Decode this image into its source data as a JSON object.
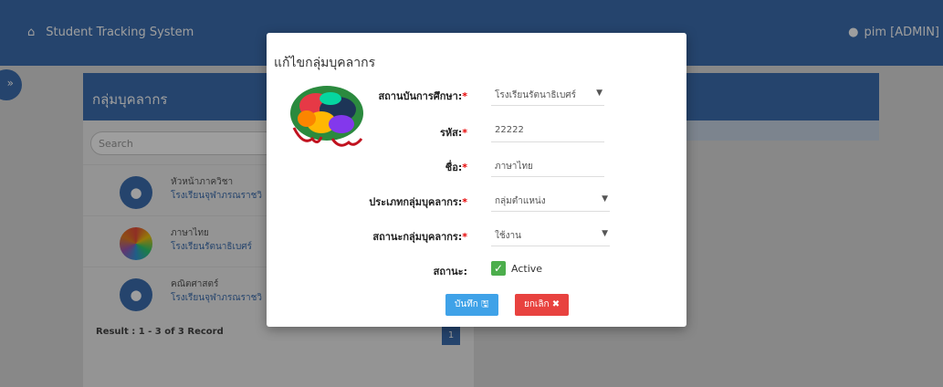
{
  "navbar": {
    "home_icon": "home-icon",
    "brand": "Student Tracking System",
    "user": "pim  [ADMIN]"
  },
  "left_panel": {
    "title": "กลุ่มบุคลากร",
    "search_placeholder": "Search",
    "items": [
      {
        "title": "หัวหน้าภาควิชา",
        "sub": "โรงเรียนจุฬาภรณราชวิ"
      },
      {
        "title": "ภาษาไทย",
        "sub": "โรงเรียนรัตนาธิเบศร์"
      },
      {
        "title": "คณิตศาสตร์",
        "sub": "โรงเรียนจุฬาภรณราชวิ"
      }
    ],
    "result": "Result : 1 - 3 of 3 Record",
    "page": "1"
  },
  "modal": {
    "title": "แก้ไขกลุ่มบุคลากร",
    "fields": {
      "institution": {
        "label": "สถานบันการศึกษา:",
        "value": "โรงเรียนรัตนาธิเบศร์"
      },
      "code": {
        "label": "รหัส:",
        "value": "22222"
      },
      "name": {
        "label": "ชื่อ:",
        "value": "ภาษาไทย"
      },
      "group_type": {
        "label": "ประเภทกลุ่มบุคลากร:",
        "value": "กลุ่มตำแหน่ง"
      },
      "group_status": {
        "label": "สถานะกลุ่มบุคลากร:",
        "value": "ใช้งาน"
      },
      "status": {
        "label": "สถานะ:",
        "value": "Active"
      }
    },
    "save": "บันทึก 🖫",
    "cancel": "ยกเลิก ✖"
  }
}
